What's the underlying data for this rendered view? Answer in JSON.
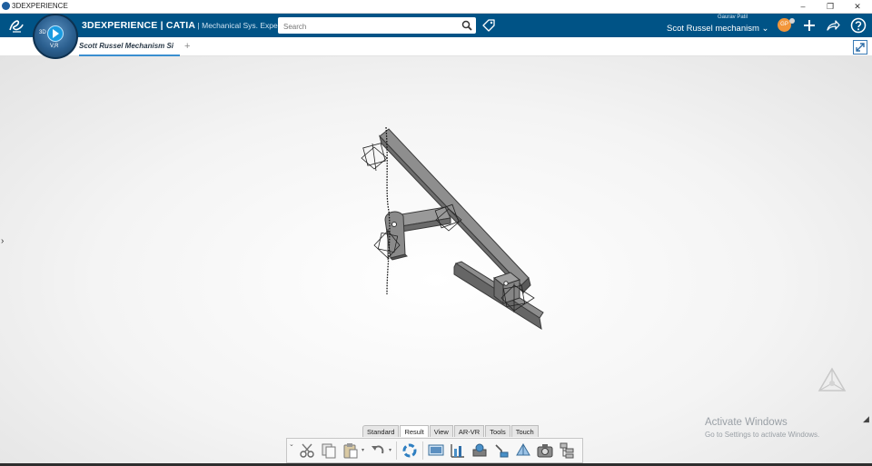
{
  "window": {
    "title": "3DEXPERIENCE",
    "controls": {
      "minimize": "–",
      "restore": "❐",
      "close": "✕"
    }
  },
  "header": {
    "brand_bold": "3DEXPERIENCE | CATIA",
    "brand_sub": " | Mechanical Sys. Experie...",
    "compass_top_label": "3D",
    "compass_bottom_label": "V,R",
    "search_placeholder": "Search",
    "user_name": "Gaurav Patil",
    "space_title": "Scot Russel mechanism",
    "avatar_initials": "GP",
    "icons": [
      "ds-logo-icon",
      "search-icon",
      "tag-icon",
      "add-icon",
      "share-icon",
      "help-icon"
    ]
  },
  "tabs": {
    "items": [
      {
        "label": "Scott Russel Mechanism Si"
      }
    ],
    "add_label": "+"
  },
  "viewport": {
    "side_arrow": "›"
  },
  "section_tabs": [
    "Standard",
    "Result",
    "View",
    "AR-VR",
    "Tools",
    "Touch"
  ],
  "active_section": "Result",
  "action_bar": {
    "icons": [
      "cut-icon",
      "copy-icon",
      "paste-icon",
      "undo-icon",
      "update-icon",
      "camera-view-icon",
      "measure-icon",
      "simulation-icon",
      "sensor-icon",
      "fly-mode-icon",
      "capture-icon",
      "tree-icon"
    ]
  },
  "watermark": {
    "line1": "Activate Windows",
    "line2": "Go to Settings to activate Windows."
  },
  "colors": {
    "header_bg": "#005386",
    "accent": "#3a8fd0",
    "avatar": "#f2963a"
  }
}
